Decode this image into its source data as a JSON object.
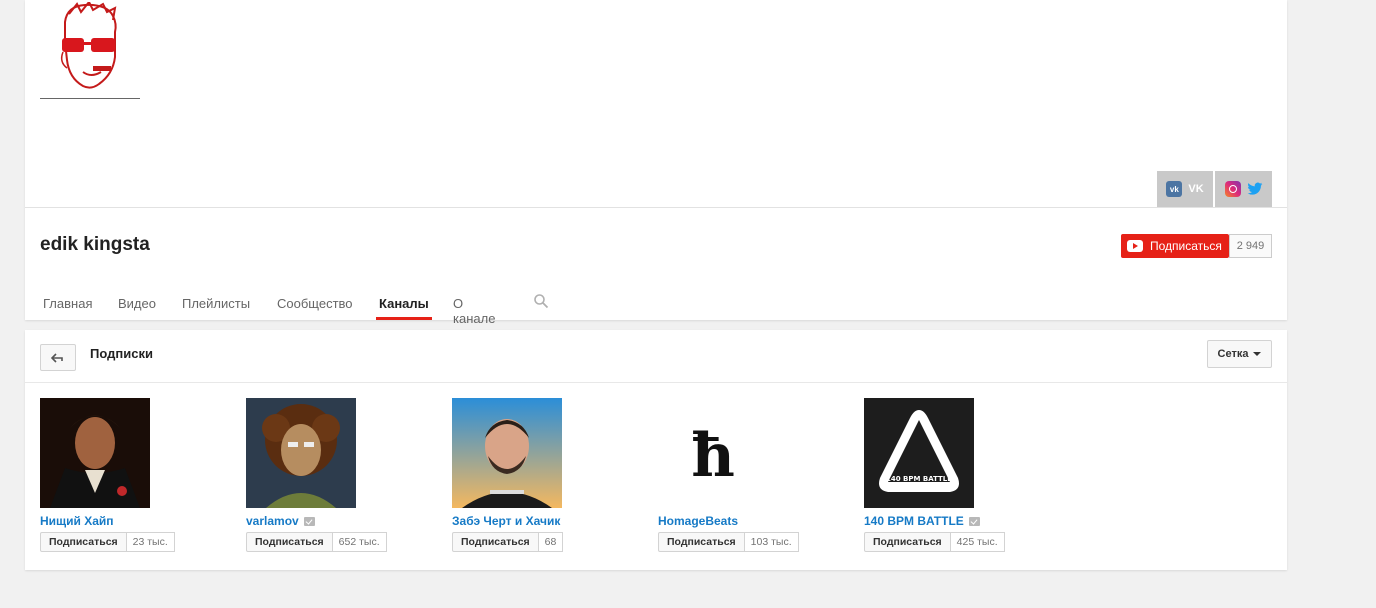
{
  "channel": {
    "name": "edik kingsta",
    "subscribe_label": "Подписаться",
    "subscriber_count": "2 949"
  },
  "social": {
    "vk_label": "VK"
  },
  "tabs": [
    {
      "label": "Главная",
      "active": false
    },
    {
      "label": "Видео",
      "active": false
    },
    {
      "label": "Плейлисты",
      "active": false
    },
    {
      "label": "Сообщество",
      "active": false
    },
    {
      "label": "Каналы",
      "active": true
    },
    {
      "label": "О канале",
      "active": false
    }
  ],
  "section": {
    "title": "Подписки",
    "view_label": "Сетка"
  },
  "channels": [
    {
      "name": "Нищий Хайп",
      "verified": false,
      "subscribe_label": "Подписаться",
      "count": "23 тыс."
    },
    {
      "name": "varlamov",
      "verified": true,
      "subscribe_label": "Подписаться",
      "count": "652 тыс."
    },
    {
      "name": "Забэ Черт и Хачик",
      "verified": false,
      "subscribe_label": "Подписаться",
      "count": "68"
    },
    {
      "name": "HomageBeats",
      "verified": false,
      "subscribe_label": "Подписаться",
      "count": "103 тыс."
    },
    {
      "name": "140 BPM BATTLE",
      "verified": true,
      "subscribe_label": "Подписаться",
      "count": "425 тыс."
    }
  ],
  "thumb_texts": {
    "homage_logo": "ħ",
    "bpm_logo": "140 BPM BATTLE"
  },
  "colors": {
    "accent_red": "#e62117",
    "link_blue": "#167ac6"
  }
}
